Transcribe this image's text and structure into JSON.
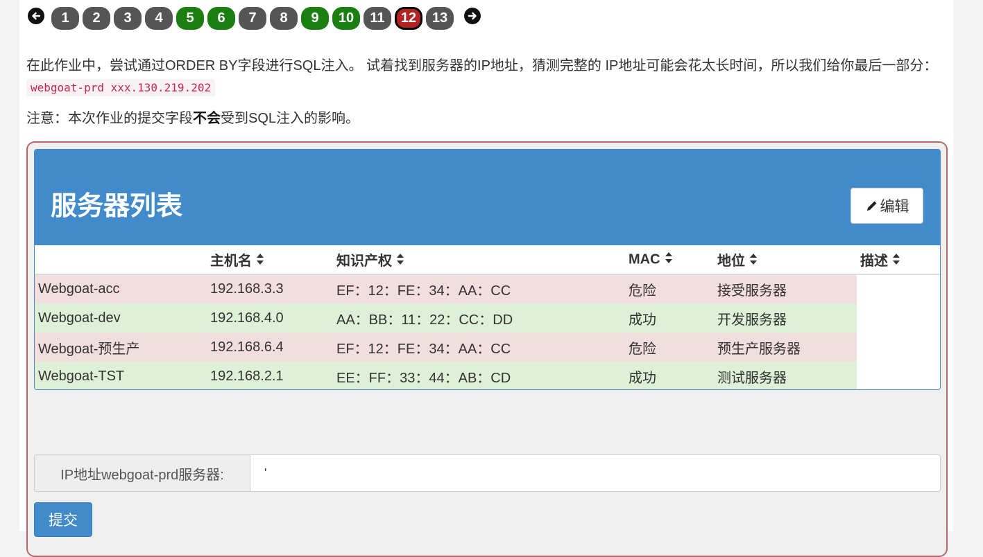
{
  "pagination": {
    "pages": [
      {
        "label": "1",
        "status": "default"
      },
      {
        "label": "2",
        "status": "default"
      },
      {
        "label": "3",
        "status": "default"
      },
      {
        "label": "4",
        "status": "default"
      },
      {
        "label": "5",
        "status": "completed"
      },
      {
        "label": "6",
        "status": "completed"
      },
      {
        "label": "7",
        "status": "default"
      },
      {
        "label": "8",
        "status": "default"
      },
      {
        "label": "9",
        "status": "completed"
      },
      {
        "label": "10",
        "status": "completed"
      },
      {
        "label": "11",
        "status": "default"
      },
      {
        "label": "12",
        "status": "current"
      },
      {
        "label": "13",
        "status": "default"
      }
    ],
    "prev_icon": "arrow-left-circle-icon",
    "next_icon": "arrow-right-circle-icon"
  },
  "intro": {
    "text_part1": "在此作业中，尝试通过ORDER BY字段进行SQL注入。 试着找到服务器的IP地址，猜测完整的 IP地址可能会花太长时间，所以我们给你最后一部分：",
    "code": "webgoat-prd xxx.130.219.202"
  },
  "note": {
    "prefix": "注意：本次作业的提交字段",
    "bold": "不会",
    "suffix": "受到SQL注入的影响。"
  },
  "panel": {
    "title": "服务器列表",
    "edit_label": "编辑",
    "edit_icon": "pencil-icon"
  },
  "table": {
    "headers": [
      "",
      "主机名",
      "知识产权",
      "MAC",
      "地位",
      "描述"
    ],
    "rows": [
      {
        "name": "Webgoat-acc",
        "ip": "192.168.3.3",
        "mac": "EF：12：FE：34：AA：CC",
        "status": "危险",
        "description": "接受服务器",
        "row_type": "danger"
      },
      {
        "name": "Webgoat-dev",
        "ip": "192.168.4.0",
        "mac": "AA：BB：11：22：CC：DD",
        "status": "成功",
        "description": "开发服务器",
        "row_type": "success"
      },
      {
        "name": "Webgoat-预生产",
        "ip": "192.168.6.4",
        "mac": "EF：12：FE：34：AA：CC",
        "status": "危险",
        "description": "预生产服务器",
        "row_type": "danger"
      },
      {
        "name": "Webgoat-TST",
        "ip": "192.168.2.1",
        "mac": "EE：FF：33：44：AB：CD",
        "status": "成功",
        "description": "测试服务器",
        "row_type": "success"
      }
    ],
    "sort_icon": "sort-icon"
  },
  "form": {
    "ip_label": "IP地址webgoat-prd服务器:",
    "ip_value": "'",
    "submit_label": "提交"
  },
  "colors": {
    "completed": "#1a7f10",
    "current": "#b52222",
    "default": "#555555",
    "primary": "#428bca",
    "danger_row": "#f2dede",
    "success_row": "#dff0d8"
  }
}
